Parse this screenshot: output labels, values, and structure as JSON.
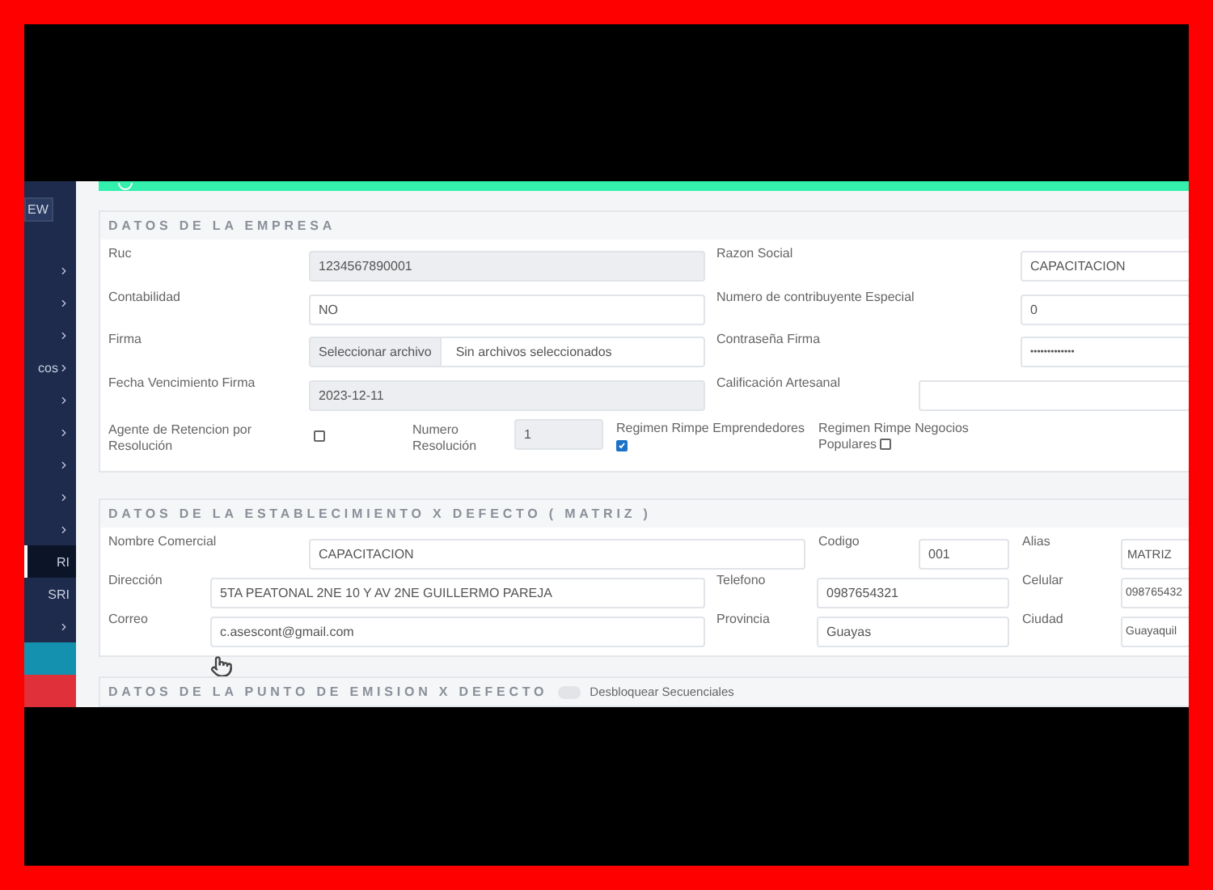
{
  "sidebar": {
    "badge": "EW",
    "items": [
      {
        "has_submenu": true,
        "selected": false
      },
      {
        "has_submenu": true,
        "selected": false
      },
      {
        "has_submenu": true,
        "selected": false
      },
      {
        "label": "cos",
        "has_submenu": true,
        "selected": false
      },
      {
        "has_submenu": true,
        "selected": false
      },
      {
        "has_submenu": true,
        "selected": false
      },
      {
        "has_submenu": true,
        "selected": false
      },
      {
        "has_submenu": true,
        "selected": false
      },
      {
        "has_submenu": true,
        "selected": false
      },
      {
        "label": "RI",
        "has_submenu": false,
        "selected": true
      },
      {
        "label": "SRI",
        "has_submenu": false,
        "selected": false
      },
      {
        "has_submenu": true,
        "selected": false
      },
      {
        "has_submenu": false,
        "selected": false,
        "color": "#1591b0"
      },
      {
        "has_submenu": false,
        "selected": false,
        "color": "#e0303a"
      }
    ]
  },
  "empresa": {
    "title": "DATOS DE LA EMPRESA",
    "ruc": {
      "label": "Ruc",
      "value": "1234567890001",
      "readonly": true
    },
    "razon_social": {
      "label": "Razon Social",
      "value": "CAPACITACION",
      "readonly": false
    },
    "contabilidad": {
      "label": "Contabilidad",
      "value": "NO",
      "readonly": false
    },
    "contribuyente_especial": {
      "label": "Numero de contribuyente Especial",
      "value": "0",
      "readonly": false
    },
    "firma": {
      "label": "Firma",
      "button": "Seleccionar archivo",
      "status": "Sin archivos seleccionados"
    },
    "contrasena_firma": {
      "label": "Contraseña Firma",
      "value": "•••••••••••••",
      "readonly": false
    },
    "fecha_vencimiento": {
      "label": "Fecha Vencimiento Firma",
      "value": "2023-12-11",
      "readonly": true
    },
    "calificacion_artesanal": {
      "label": "Calificación Artesanal",
      "readonly": false
    },
    "agente_retencion": {
      "label": "Agente de Retencion por Resolución",
      "checked": false
    },
    "numero_resolucion": {
      "label": "Numero Resolución",
      "value": "1",
      "readonly": true
    },
    "rimpe_emprendedores": {
      "label": "Regimen Rimpe Emprendedores",
      "checked": true
    },
    "rimpe_negocios_populares": {
      "label": "Regimen Rimpe Negocios Populares",
      "checked": false
    }
  },
  "establecimiento": {
    "title": "DATOS DE LA ESTABLECIMIENTO X DEFECTO ( MATRIZ )",
    "nombre_comercial": {
      "label": "Nombre Comercial",
      "value": "CAPACITACION",
      "readonly": false
    },
    "codigo": {
      "label": "Codigo",
      "value": "001",
      "readonly": false
    },
    "alias": {
      "label": "Alias",
      "value": "MATRIZ",
      "readonly": false
    },
    "direccion": {
      "label": "Dirección",
      "value": "5TA PEATONAL 2NE 10 Y AV 2NE GUILLERMO PAREJA",
      "readonly": false
    },
    "telefono": {
      "label": "Telefono",
      "value": "0987654321",
      "readonly": false
    },
    "celular": {
      "label": "Celular",
      "value": "098765432",
      "readonly": false
    },
    "correo": {
      "label": "Correo",
      "value": "c.asescont@gmail.com",
      "readonly": false
    },
    "provincia": {
      "label": "Provincia",
      "value": "Guayas",
      "readonly": false
    },
    "ciudad": {
      "label": "Ciudad",
      "value": "Guayaquil",
      "readonly": false
    }
  },
  "punto_emision": {
    "title": "DATOS DE LA PUNTO DE EMISION X DEFECTO",
    "toggle": {
      "label": "Desbloquear Secuenciales",
      "on": false
    }
  }
}
